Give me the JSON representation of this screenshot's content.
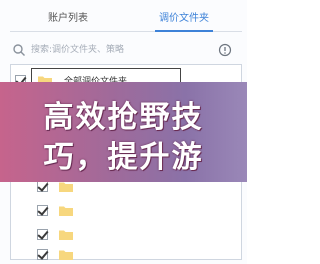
{
  "tabs": [
    {
      "label": "账户列表",
      "active": false
    },
    {
      "label": "调价文件夹",
      "active": true
    }
  ],
  "search": {
    "placeholder": "搜索:调价文件夹、策略"
  },
  "list": {
    "all_label": "全部调价文件夹",
    "row_count_checked_visible": 6
  },
  "overlay": {
    "line1": "高效抢野技",
    "line2": "巧，提升游"
  },
  "colors": {
    "accent": "#3d82d8",
    "folder": "#f7d77e",
    "overlay_start": "#c6648c",
    "overlay_end": "#9a88b8"
  },
  "icons": {
    "search": "search-icon",
    "info": "info-icon",
    "folder": "folder-icon",
    "checkbox": "checkbox-icon"
  }
}
